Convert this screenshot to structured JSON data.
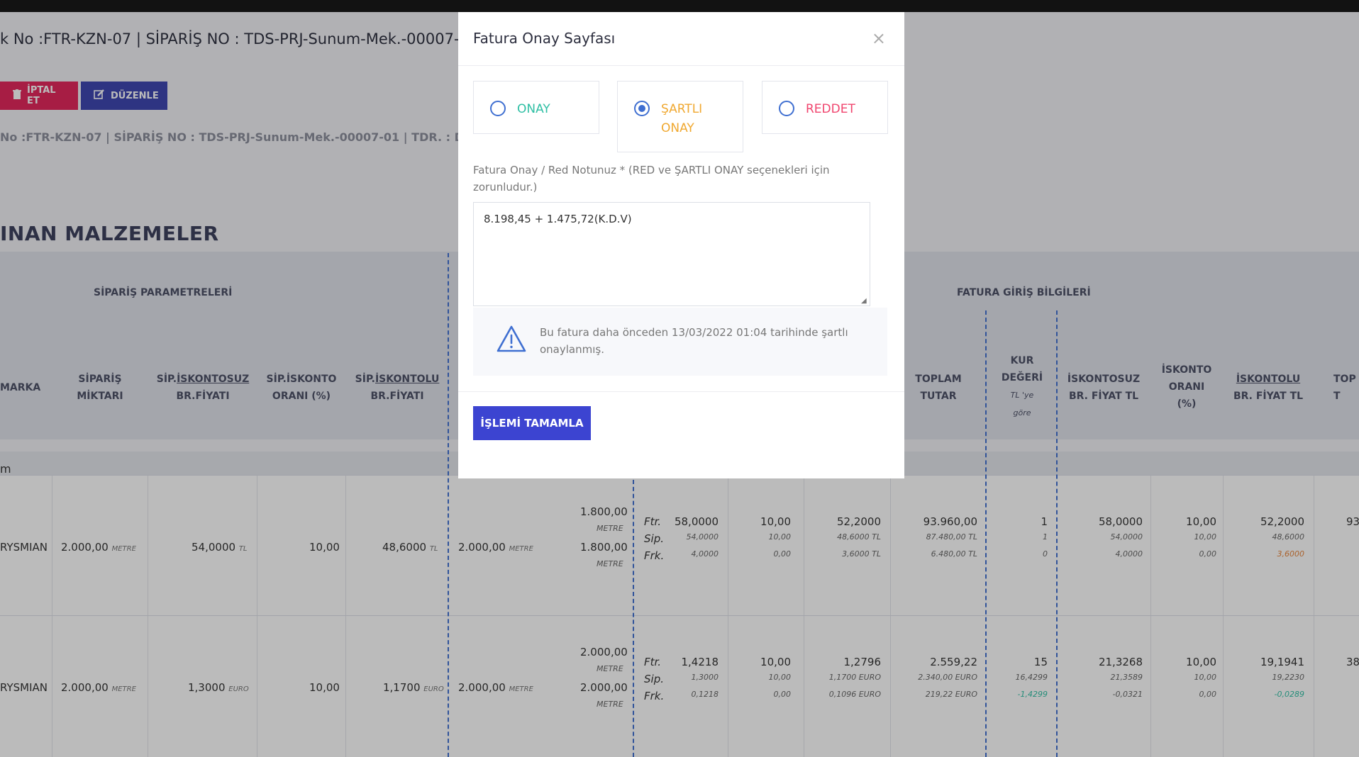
{
  "page": {
    "title": "k No :FTR-KZN-07 | SİPARİŞ NO : TDS-PRJ-Sunum-Mek.-00007-",
    "cancel_label": "İPTAL ET",
    "edit_label": "DÜZENLE",
    "subline": "No :FTR-KZN-07 | SİPARİŞ NO : TDS-PRJ-Sunum-Mek.-00007-01 | TDR. : D",
    "section_title": "INAN MALZEMELER",
    "group_left": "SİPARİŞ PARAMETRELERİ",
    "group_right": "FATURA GİRİŞ BİLGİLERİ",
    "group_row_label": "m"
  },
  "table": {
    "headers": {
      "marka": "MARKA",
      "siparis_miktari_1": "SİPARİŞ",
      "siparis_miktari_2": "MİKTARI",
      "sip_iskontosuz_1a": "SİP.",
      "sip_iskontosuz_1b": "İSKONTOSUZ",
      "sip_iskontosuz_2": "BR.FİYATI",
      "sip_iskonto_1": "SİP.İSKONTO",
      "sip_iskonto_2": "ORANI (%)",
      "sip_iskontolu_1a": "SİP.",
      "sip_iskontolu_1b": "İSKONTOLU",
      "sip_iskontolu_2": "BR.FİYATI",
      "toplam_1": "TOPLAM",
      "toplam_2": "TUTAR",
      "kur_1": "KUR",
      "kur_2": "DEĞERİ",
      "kur_3": "TL 'ye",
      "kur_4": "göre",
      "iskontosuz_tl_1": "İSKONTOSUZ",
      "iskontosuz_tl_2": "BR. FİYAT TL",
      "iskonto_1": "İSKONTO",
      "iskonto_2": "ORANI",
      "iskonto_3": "(%)",
      "iskontolu_tl_1": "İSKONTOLU",
      "iskontolu_tl_2": "BR. FİYAT TL",
      "top_cut_1": "TOP",
      "top_cut_2": "T"
    },
    "rows": [
      {
        "marka": "RYSMIAN",
        "miktar": "2.000,00",
        "miktar_unit": "METRE",
        "iskontosuz": "54,0000",
        "iskontosuz_unit": "TL",
        "oran": "10,00",
        "iskontolu": "48,6000",
        "iskontolu_unit": "TL",
        "gelen": "2.000,00",
        "gelen_unit": "METRE",
        "fat_1": "1.800,00",
        "fat_1_unit": "METRE",
        "fat_2": "1.800,00",
        "fat_2_unit": "METRE",
        "ftr": "Ftr.",
        "sip": "Sip.",
        "frk": "Frk.",
        "c1": [
          "58,0000",
          "54,0000",
          "4,0000"
        ],
        "c2": [
          "10,00",
          "10,00",
          "0,00"
        ],
        "c3": [
          "52,2000",
          "48,6000 TL",
          "3,6000 TL"
        ],
        "c4": [
          "93.960,00",
          "87.480,00 TL",
          "6.480,00 TL"
        ],
        "c5": [
          "1",
          "1",
          "0"
        ],
        "c6": [
          "58,0000",
          "54,0000",
          "4,0000"
        ],
        "c7": [
          "10,00",
          "10,00",
          "0,00"
        ],
        "c8": [
          "52,2000",
          "48,6000",
          "3,6000"
        ],
        "c9": "93"
      },
      {
        "marka": "RYSMIAN",
        "miktar": "2.000,00",
        "miktar_unit": "METRE",
        "iskontosuz": "1,3000",
        "iskontosuz_unit": "EURO",
        "oran": "10,00",
        "iskontolu": "1,1700",
        "iskontolu_unit": "EURO",
        "gelen": "2.000,00",
        "gelen_unit": "METRE",
        "fat_1": "2.000,00",
        "fat_1_unit": "METRE",
        "fat_2": "2.000,00",
        "fat_2_unit": "METRE",
        "ftr": "Ftr.",
        "sip": "Sip.",
        "frk": "Frk.",
        "c1": [
          "1,4218",
          "1,3000",
          "0,1218"
        ],
        "c2": [
          "10,00",
          "10,00",
          "0,00"
        ],
        "c3": [
          "1,2796",
          "1,1700 EURO",
          "0,1096 EURO"
        ],
        "c4": [
          "2.559,22",
          "2.340,00 EURO",
          "219,22 EURO"
        ],
        "c5": [
          "15",
          "16,4299",
          "-1,4299"
        ],
        "c6": [
          "21,3268",
          "21,3589",
          "-0,0321"
        ],
        "c7": [
          "10,00",
          "10,00",
          "0,00"
        ],
        "c8": [
          "19,1941",
          "19,2230",
          "-0,0289"
        ],
        "c9": "38"
      }
    ]
  },
  "modal": {
    "title": "Fatura Onay Sayfası",
    "close_symbol": "×",
    "options": [
      {
        "label": "ONAY",
        "color": "#2fbfa4",
        "selected": false
      },
      {
        "label": "ŞARTLI ONAY",
        "color": "#f0a830",
        "selected": true
      },
      {
        "label": "REDDET",
        "color": "#f0456e",
        "selected": false
      }
    ],
    "note_label": "Fatura Onay / Red Notunuz * (RED ve ŞARTLI ONAY seçenekleri için zorunludur.)",
    "note_value": "8.198,45 + 1.475,72(K.D.V)",
    "alert_icon": "warning-triangle-icon",
    "alert_text": "Bu fatura daha önceden 13/03/2022 01:04 tarihinde şartlı onaylanmış.",
    "submit_label": "İŞLEMİ TAMAMLA"
  },
  "colors": {
    "accent": "#3c44d1",
    "cancel": "#e4245a",
    "edit": "#3c44b1",
    "dashed_divider": "#3f6fd1"
  }
}
